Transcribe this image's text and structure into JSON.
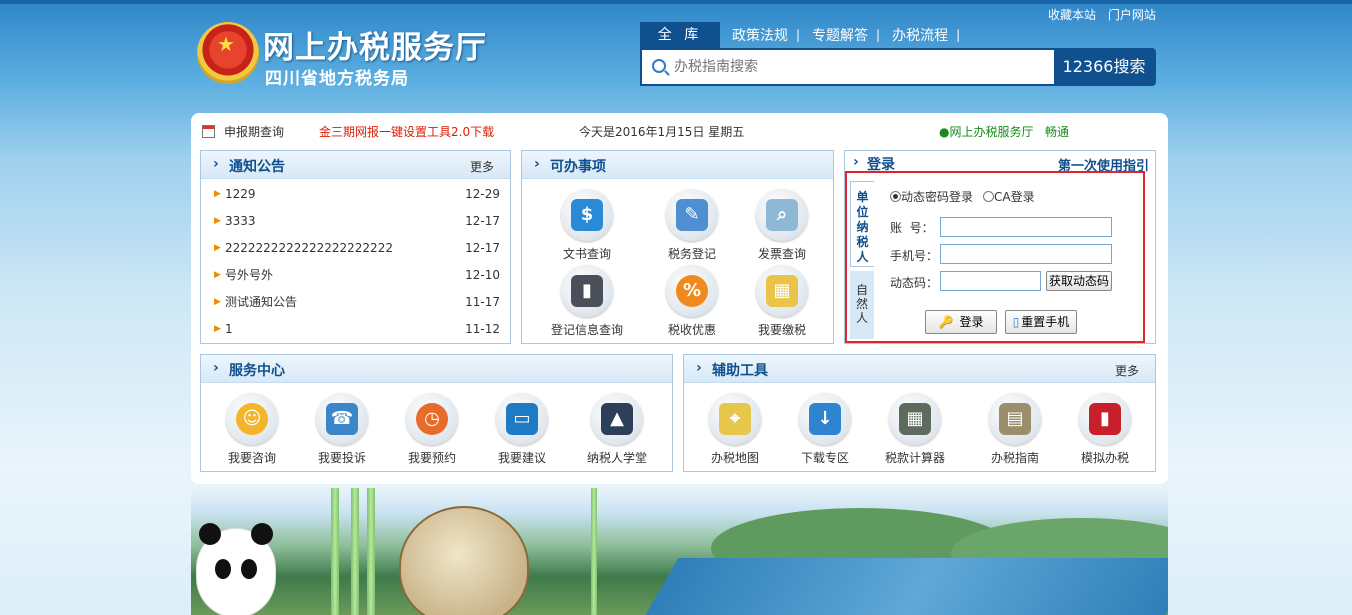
{
  "header": {
    "top_links": [
      "收藏本站",
      "门户网站"
    ],
    "logo_title": "网上办税服务厅",
    "logo_subtitle": "四川省地方税务局",
    "search_tabs": [
      {
        "label": "全 库",
        "active": true
      },
      {
        "label": "政策法规"
      },
      {
        "label": "专题解答"
      },
      {
        "label": "办税流程"
      }
    ],
    "search_placeholder": "办税指南搜索",
    "search_button": "12366搜索"
  },
  "info_bar": {
    "period_query": "申报期查询",
    "download_link": "金三期网报一键设置工具2.0下载",
    "date_text": "今天是2016年1月15日 星期五",
    "status_label": "●网上办税服务厅",
    "status_value": "畅通"
  },
  "notice": {
    "title": "通知公告",
    "more": "更多",
    "items": [
      {
        "text": "1229",
        "date": "12-29"
      },
      {
        "text": "3333",
        "date": "12-17"
      },
      {
        "text": "2222222222222222222222",
        "date": "12-17"
      },
      {
        "text": "号外号外",
        "date": "12-10"
      },
      {
        "text": "测试通知公告",
        "date": "11-17"
      },
      {
        "text": "1",
        "date": "11-12"
      }
    ]
  },
  "tasks": {
    "title": "可办事项",
    "items": [
      {
        "label": "文书查询",
        "icon": "document-money-icon"
      },
      {
        "label": "税务登记",
        "icon": "registration-form-icon"
      },
      {
        "label": "发票查询",
        "icon": "magnifier-icon"
      },
      {
        "label": "登记信息查询",
        "icon": "book-icon"
      },
      {
        "label": "税收优惠",
        "icon": "percent-icon"
      },
      {
        "label": "我要缴税",
        "icon": "calculator-coins-icon"
      }
    ]
  },
  "login": {
    "title": "登录",
    "guide_link": "第一次使用指引",
    "tab_unit": "单位纳税人",
    "tab_natural": "自然人",
    "radio_dynamic": "动态密码登录",
    "radio_ca": "CA登录",
    "account_label": "账  号：",
    "phone_label": "手机号：",
    "code_label": "动态码：",
    "get_code_button": "获取动态码",
    "login_button": "登录",
    "reset_button": "重置手机"
  },
  "service_center": {
    "title": "服务中心",
    "items": [
      {
        "label": "我要咨询",
        "icon": "smiley-icon"
      },
      {
        "label": "我要投诉",
        "icon": "telephone-icon"
      },
      {
        "label": "我要预约",
        "icon": "alarm-clock-icon"
      },
      {
        "label": "我要建议",
        "icon": "inbox-icon"
      },
      {
        "label": "纳税人学堂",
        "icon": "graduation-cap-icon"
      }
    ]
  },
  "tools": {
    "title": "辅助工具",
    "more": "更多",
    "items": [
      {
        "label": "办税地图",
        "icon": "map-icon"
      },
      {
        "label": "下载专区",
        "icon": "download-icon"
      },
      {
        "label": "税款计算器",
        "icon": "calculator-icon"
      },
      {
        "label": "办税指南",
        "icon": "guide-image-icon"
      },
      {
        "label": "模拟办税",
        "icon": "simulation-icon"
      }
    ]
  }
}
